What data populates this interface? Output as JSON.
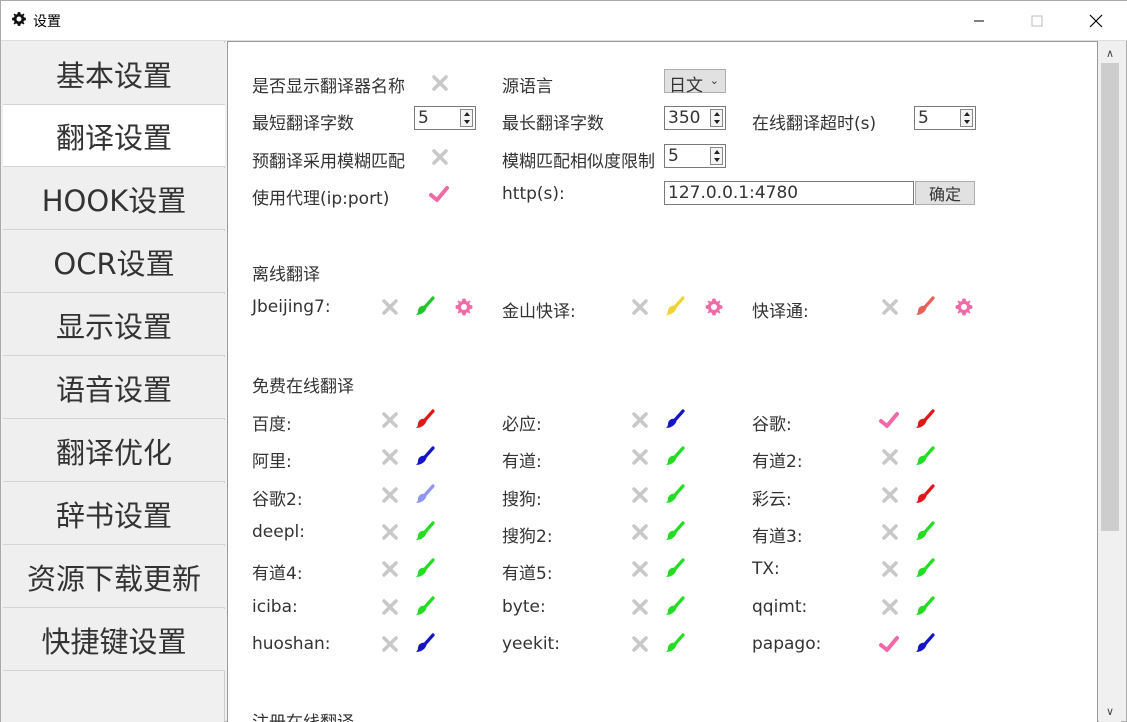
{
  "window": {
    "title": "设置"
  },
  "sidebar": {
    "items": [
      {
        "label": "基本设置"
      },
      {
        "label": "翻译设置"
      },
      {
        "label": "HOOK设置"
      },
      {
        "label": "OCR设置"
      },
      {
        "label": "显示设置"
      },
      {
        "label": "语音设置"
      },
      {
        "label": "翻译优化"
      },
      {
        "label": "辞书设置"
      },
      {
        "label": "资源下载更新"
      },
      {
        "label": "快捷键设置"
      }
    ],
    "active_index": 1
  },
  "settings": {
    "show_name_label": "是否显示翻译器名称",
    "source_lang_label": "源语言",
    "source_lang_value": "日文",
    "min_chars_label": "最短翻译字数",
    "min_chars_value": "5",
    "max_chars_label": "最长翻译字数",
    "max_chars_value": "350",
    "timeout_label": "在线翻译超时(s)",
    "timeout_value": "5",
    "fuzzy_label": "预翻译采用模糊匹配",
    "similarity_label": "模糊匹配相似度限制",
    "similarity_value": "5",
    "proxy_label": "使用代理(ip:port)",
    "http_label": "http(s):",
    "http_value": "127.0.0.1:4780",
    "confirm_label": "确定"
  },
  "offline": {
    "title": "离线翻译",
    "items": [
      {
        "label": "Jbeijing7:",
        "enabled": false,
        "color": "#22c52a"
      },
      {
        "label": "金山快译:",
        "enabled": false,
        "color": "#f0d23a"
      },
      {
        "label": "快译通:",
        "enabled": false,
        "color": "#e8605a"
      }
    ]
  },
  "free_online": {
    "title": "免费在线翻译",
    "items": [
      {
        "label": "百度:",
        "enabled": false,
        "color": "#e01818"
      },
      {
        "label": "必应:",
        "enabled": false,
        "color": "#1515c8"
      },
      {
        "label": "谷歌:",
        "enabled": true,
        "color": "#e01818"
      },
      {
        "label": "阿里:",
        "enabled": false,
        "color": "#1515c8"
      },
      {
        "label": "有道:",
        "enabled": false,
        "color": "#22dd22"
      },
      {
        "label": "有道2:",
        "enabled": false,
        "color": "#22dd22"
      },
      {
        "label": "谷歌2:",
        "enabled": false,
        "color": "#8f96f0"
      },
      {
        "label": "搜狗:",
        "enabled": false,
        "color": "#22dd22"
      },
      {
        "label": "彩云:",
        "enabled": false,
        "color": "#e01818"
      },
      {
        "label": "deepl:",
        "enabled": false,
        "color": "#22dd22"
      },
      {
        "label": "搜狗2:",
        "enabled": false,
        "color": "#22dd22"
      },
      {
        "label": "有道3:",
        "enabled": false,
        "color": "#22dd22"
      },
      {
        "label": "有道4:",
        "enabled": false,
        "color": "#22dd22"
      },
      {
        "label": "有道5:",
        "enabled": false,
        "color": "#22dd22"
      },
      {
        "label": "TX:",
        "enabled": false,
        "color": "#22dd22"
      },
      {
        "label": "iciba:",
        "enabled": false,
        "color": "#22dd22"
      },
      {
        "label": "byte:",
        "enabled": false,
        "color": "#22dd22"
      },
      {
        "label": "qqimt:",
        "enabled": false,
        "color": "#22dd22"
      },
      {
        "label": "huoshan:",
        "enabled": false,
        "color": "#1515c8"
      },
      {
        "label": "yeekit:",
        "enabled": false,
        "color": "#22dd22"
      },
      {
        "label": "papago:",
        "enabled": true,
        "color": "#1515c8"
      }
    ]
  },
  "registered_online": {
    "title": "注册在线翻译"
  },
  "colors": {
    "check": "#f06aa8",
    "x": "#c8c8c8",
    "gear": "#f06aa8"
  }
}
